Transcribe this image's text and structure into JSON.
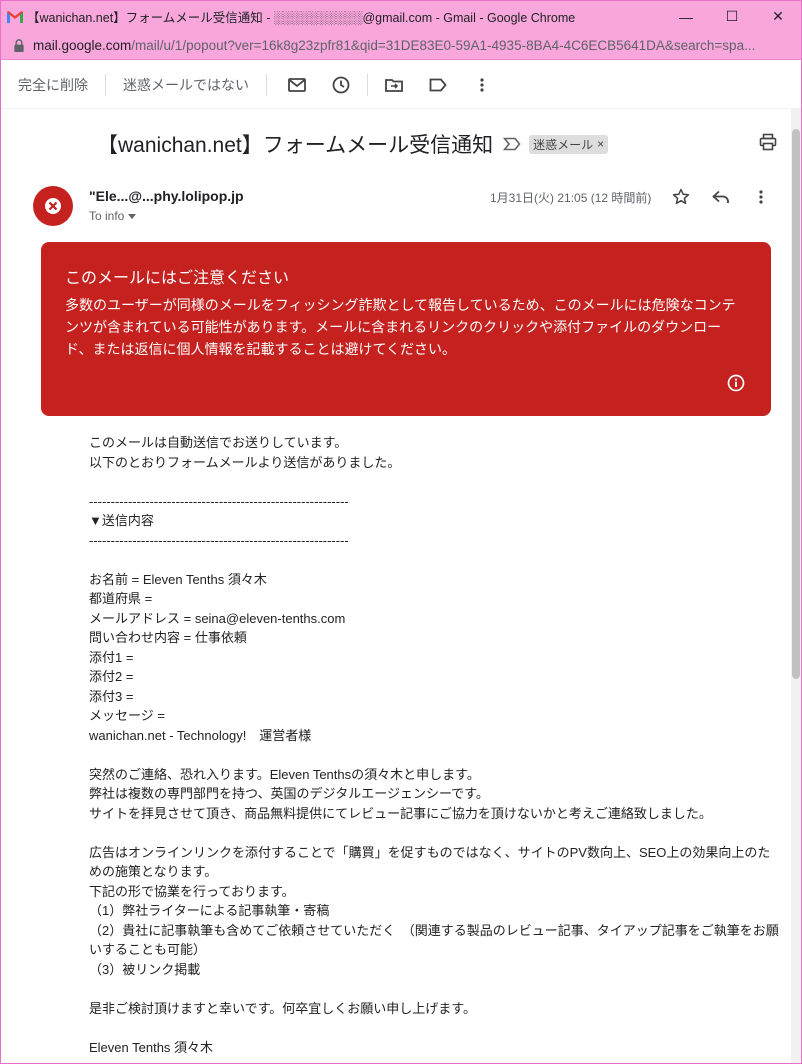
{
  "window": {
    "title": "【wanichan.net】フォームメール受信通知 - ░░░░░░░░░░@gmail.com - Gmail - Google Chrome",
    "url_main": "mail.google.com",
    "url_rest": "/mail/u/1/popout?ver=16k8g23zpfr81&qid=31DE83E0-59A1-4935-8BA4-4C6ECB5641DA&search=spa..."
  },
  "toolbar": {
    "delete_forever": "完全に削除",
    "not_spam": "迷惑メールではない"
  },
  "message": {
    "subject": "【wanichan.net】フォームメール受信通知",
    "spam_label": "迷惑メール",
    "spam_close": "×",
    "sender": "\"Ele...@...phy.lolipop.jp",
    "to_info": "To info",
    "date": "1月31日(火) 21:05 (12 時間前)"
  },
  "warning": {
    "title": "このメールにはご注意ください",
    "body": "多数のユーザーが同様のメールをフィッシング詐欺として報告しているため、このメールには危険なコンテンツが含まれている可能性があります。メールに含まれるリンクのクリックや添付ファイルのダウンロード、または返信に個人情報を記載することは避けてください。"
  },
  "body_lines": [
    "このメールは自動送信でお送りしています。",
    "以下のとおりフォームメールより送信がありました。",
    "",
    "------------------------------------------------------------",
    "▼送信内容",
    "------------------------------------------------------------",
    "",
    "お名前 = Eleven Tenths 須々木",
    "都道府県 =",
    "メールアドレス = seina@eleven-tenths.com",
    "問い合わせ内容 = 仕事依頼",
    "添付1 =",
    "添付2 =",
    "添付3 =",
    "メッセージ =",
    "wanichan.net - Technology!　運営者様",
    "",
    "突然のご連絡、恐れ入ります。Eleven Tenthsの須々木と申します。",
    "弊社は複数の専門部門を持つ、英国のデジタルエージェンシーです。",
    "サイトを拝見させて頂き、商品無料提供にてレビュー記事にご協力を頂けないかと考えご連絡致しました。",
    "",
    "広告はオンラインリンクを添付することで「購買」を促すものではなく、サイトのPV数向上、SEO上の効果向上のための施策となります。",
    "下記の形で協業を行っております。",
    "（1）弊社ライターによる記事執筆・寄稿",
    "（2）貴社に記事執筆も含めてご依頼させていただく　（関連する製品のレビュー記事、タイアップ記事をご執筆をお願いすることも可能）",
    "（3）被リンク掲載",
    "",
    "是非ご検討頂けますと幸いです。何卒宜しくお願い申し上げます。",
    "",
    "Eleven Tenths 須々木"
  ],
  "colors": {
    "titlebar": "#f9a6dd",
    "warning": "#c5221f"
  },
  "icons": [
    "gmail-logo-icon",
    "lock-icon",
    "mail-icon",
    "clock-icon",
    "move-to-icon",
    "label-icon",
    "more-vert-icon",
    "important-icon",
    "print-icon",
    "blocked-avatar-icon",
    "star-icon",
    "reply-icon",
    "info-icon"
  ]
}
